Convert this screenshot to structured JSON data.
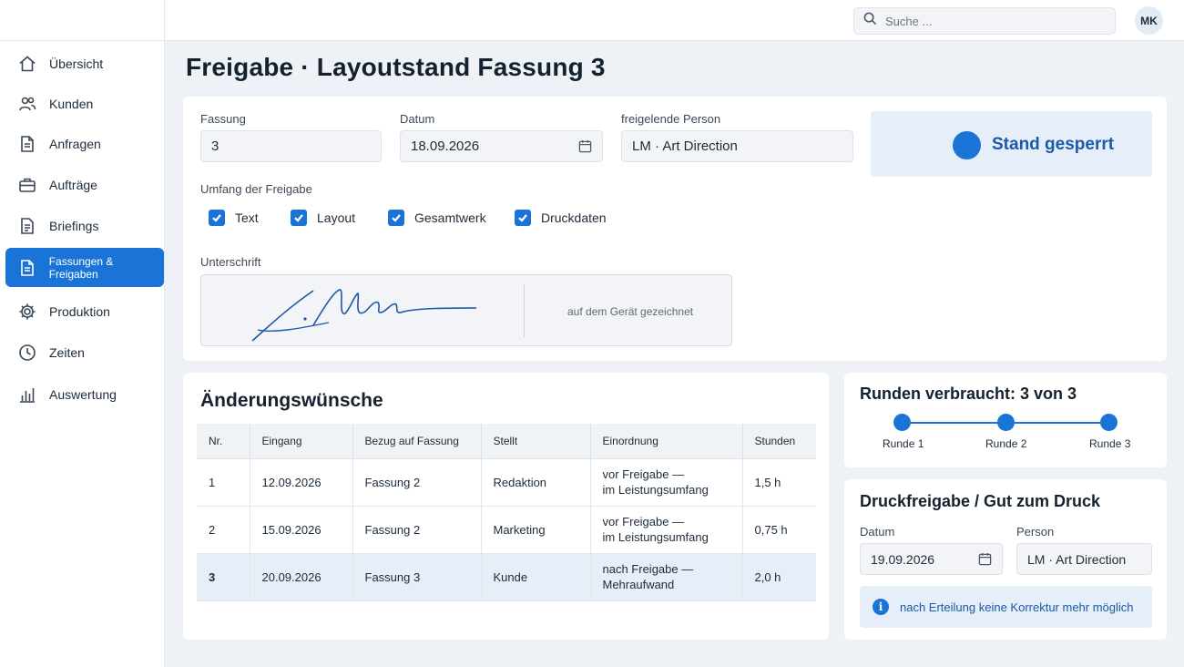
{
  "sidebar": {
    "items": [
      {
        "label": "Übersicht",
        "icon": "home-icon"
      },
      {
        "label": "Kunden",
        "icon": "users-icon"
      },
      {
        "label": "Anfragen",
        "icon": "document-icon"
      },
      {
        "label": "Aufträge",
        "icon": "briefcase-icon"
      },
      {
        "label": "Briefings",
        "icon": "file-text-icon"
      },
      {
        "label": "Fassungen & Freigaben",
        "icon": "document-icon",
        "active": true
      },
      {
        "label": "Produktion",
        "icon": "gear-icon"
      },
      {
        "label": "Zeiten",
        "icon": "clock-icon"
      },
      {
        "label": "Auswertung",
        "icon": "bar-chart-icon"
      }
    ]
  },
  "topbar": {
    "search_placeholder": "Suche ...",
    "avatar_initials": "MK"
  },
  "page": {
    "title": "Freigabe · Layoutstand Fassung 3"
  },
  "release_form": {
    "fassung_label": "Fassung",
    "fassung_value": "3",
    "datum_label": "Datum",
    "datum_value": "18.09.2026",
    "person_label": "freigelende Person",
    "person_value": "LM · Art Direction",
    "status_text": "Stand gesperrt",
    "scope_label": "Umfang der Freigabe",
    "scope_items": [
      {
        "label": "Text",
        "checked": true
      },
      {
        "label": "Layout",
        "checked": true
      },
      {
        "label": "Gesamtwerk",
        "checked": true
      },
      {
        "label": "Druckdaten",
        "checked": true
      }
    ],
    "signature_label": "Unterschrift",
    "signature_note": "auf dem Gerät gezeichnet"
  },
  "changes": {
    "title": "Änderungswünsche",
    "columns": [
      "Nr.",
      "Eingang",
      "Bezug auf Fassung",
      "Stellt",
      "Einordnung",
      "Stunden"
    ],
    "rows": [
      {
        "nr": "1",
        "eingang": "12.09.2026",
        "bezug": "Fassung 2",
        "stellt": "Redaktion",
        "einordnung_1": "vor Freigabe —",
        "einordnung_2": "im Leistungsumfang",
        "stunden": "1,5 h"
      },
      {
        "nr": "2",
        "eingang": "15.09.2026",
        "bezug": "Fassung 2",
        "stellt": "Marketing",
        "einordnung_1": "vor Freigabe —",
        "einordnung_2": "im Leistungsumfang",
        "stunden": "0,75 h"
      },
      {
        "nr": "3",
        "eingang": "20.09.2026",
        "bezug": "Fassung 3",
        "stellt": "Kunde",
        "einordnung_1": "nach Freigabe —",
        "einordnung_2": "Mehraufwand",
        "stunden": "2,0 h",
        "highlighted": true
      }
    ]
  },
  "rounds": {
    "title": "Runden verbraucht: 3 von 3",
    "used": 3,
    "total": 3,
    "labels": [
      "Runde 1",
      "Runde 2",
      "Runde 3"
    ]
  },
  "print_release": {
    "title": "Druckfreigabe / Gut zum Druck",
    "datum_label": "Datum",
    "datum_value": "19.09.2026",
    "person_label": "Person",
    "person_value": "LM · Art Direction",
    "info_text": "nach Erteilung keine Korrektur mehr möglich"
  },
  "colors": {
    "accent": "#1a74d8",
    "accent_light": "#e5eef9",
    "background": "#eef1f5"
  }
}
